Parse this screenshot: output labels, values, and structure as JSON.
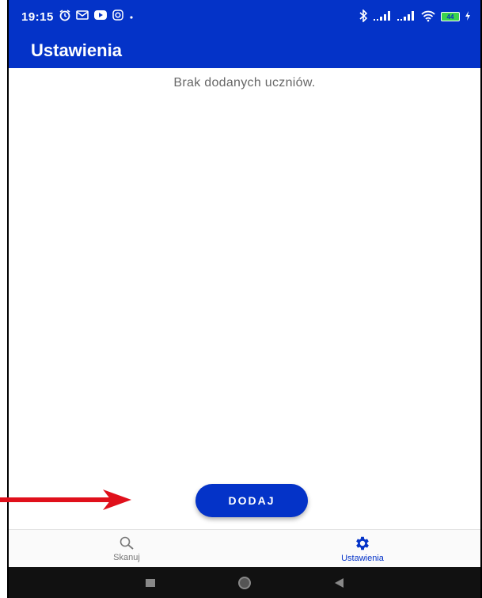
{
  "status_bar": {
    "time": "19:15",
    "battery": "44"
  },
  "app_bar": {
    "title": "Ustawienia"
  },
  "main": {
    "empty_message": "Brak dodanych uczniów.",
    "add_button_label": "DODAJ"
  },
  "bottom_nav": {
    "items": [
      {
        "label": "Skanuj",
        "icon": "search-icon",
        "active": false
      },
      {
        "label": "Ustawienia",
        "icon": "gear-icon",
        "active": true
      }
    ]
  },
  "colors": {
    "primary": "#0433c8",
    "annotation_arrow": "#e0101b"
  }
}
